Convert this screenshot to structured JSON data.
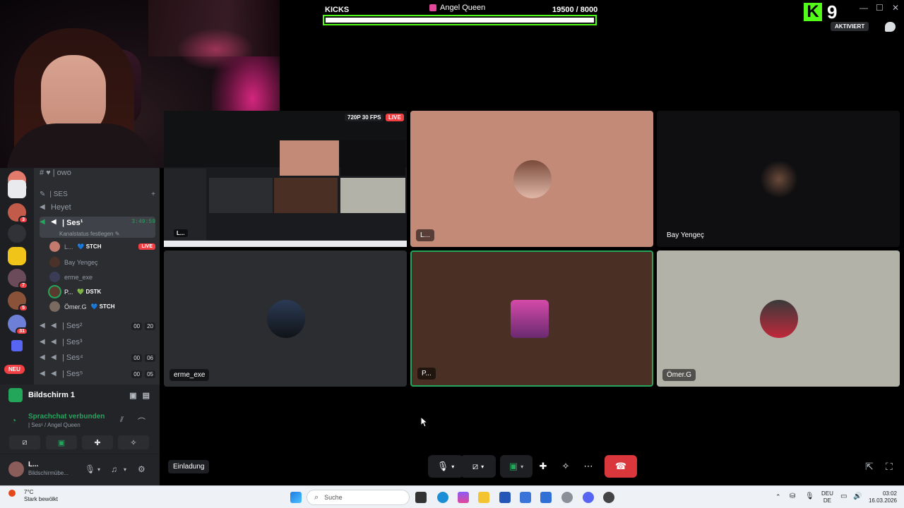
{
  "kicks": {
    "title": "KICKS",
    "user": "Angel Queen",
    "count": "19500  / 8000",
    "progress": 1.0
  },
  "kick_logo": {
    "letter": "K",
    "number": "9"
  },
  "aktiviert": "AKTIVIERT",
  "window_controls": [
    "—",
    "☐",
    "✕"
  ],
  "servers": [
    {
      "color": "#e27b6b",
      "badge": "1"
    },
    {
      "color": "#e8eaed",
      "badge": ""
    },
    {
      "color": "#c25b4a",
      "badge": "3"
    },
    {
      "color": "#303238",
      "badge": ""
    },
    {
      "color": "#f0c419",
      "badge": ""
    },
    {
      "color": "#6b4a5a",
      "badge": "7"
    },
    {
      "color": "#8a5238",
      "badge": "5"
    },
    {
      "color": "#6d7fd6",
      "badge": "31"
    },
    {
      "color": "#5865f2",
      "badge": ""
    }
  ],
  "neu_label": "NEU",
  "sidebar": {
    "top_channel": "# ♥ | owo",
    "category": "| SES",
    "channel_heyet": "Heyet",
    "active_channel": "| Ses¹",
    "active_time": "3:49:59",
    "active_sub": "Kanalstatus festlegen ✎",
    "voice_users": [
      {
        "name": "L...",
        "tag": "💙 STCH",
        "live": "LIVE",
        "color": "#c27a6e"
      },
      {
        "name": "Bay Yengeç",
        "tag": "",
        "live": "",
        "color": "#4a3228"
      },
      {
        "name": "erme_exe",
        "tag": "",
        "live": "",
        "color": "#3a3d55"
      },
      {
        "name": "P...",
        "tag": "💚 DSTK",
        "live": "",
        "color": "#5a3a2e"
      },
      {
        "name": "Ömer.G",
        "tag": "💙 STCH",
        "live": "",
        "color": "#7a6a60"
      }
    ],
    "channels": [
      {
        "name": "| Ses²",
        "counts": [
          "00",
          "20"
        ]
      },
      {
        "name": "| Ses³",
        "counts": []
      },
      {
        "name": "| Ses⁴",
        "counts": [
          "00",
          "06"
        ]
      },
      {
        "name": "| Ses⁵",
        "counts": [
          "00",
          "05"
        ]
      }
    ]
  },
  "screen_share": {
    "label": "Bildschirm 1"
  },
  "voice_panel": {
    "title": "Sprachchat verbunden",
    "sub": "| Ses¹ / Angel Queen"
  },
  "user_panel": {
    "name": "L...",
    "status": "Bildschirmübe..."
  },
  "preview": {
    "quality": "720P 30 FPS",
    "live": "LIVE",
    "label": "L..."
  },
  "tiles": [
    {
      "name": "L...",
      "bg": "#c48a78"
    },
    {
      "name": "Bay Yengeç",
      "bg": "#0f0f11"
    },
    {
      "name": "erme_exe",
      "bg": "#2b2d31"
    },
    {
      "name": "P...",
      "bg": "#4a3024"
    },
    {
      "name": "Ömer.G",
      "bg": "#b3b2a8"
    }
  ],
  "einladung": "Einladung",
  "taskbar": {
    "temp": "7°C",
    "weather": "Stark bewölkt",
    "search": "Suche",
    "lang_top": "DEU",
    "lang_bottom": "DE",
    "time": "03:02",
    "date": "16.03.2026"
  }
}
